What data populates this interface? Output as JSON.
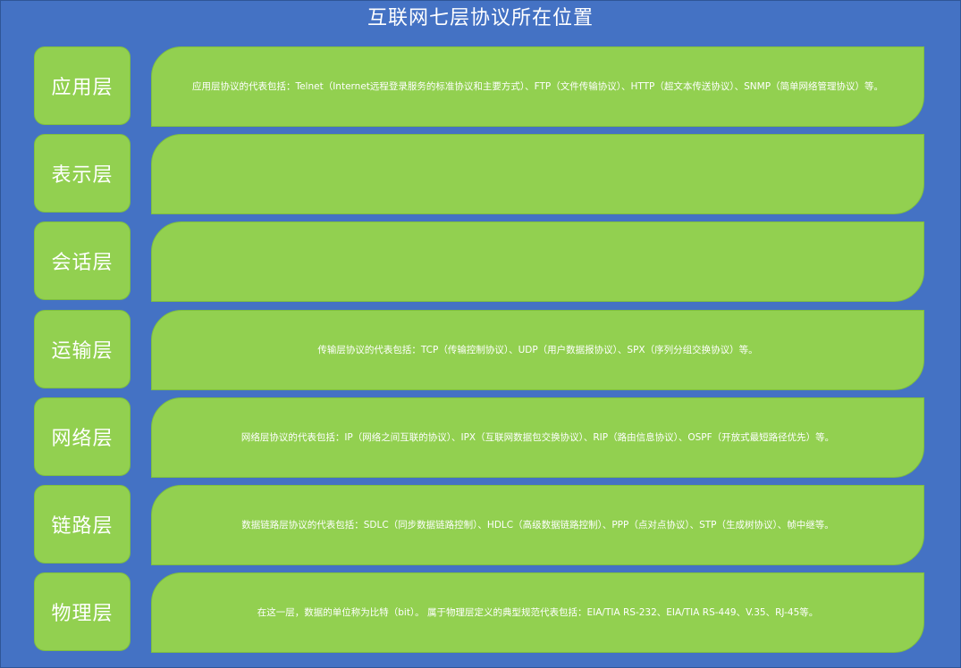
{
  "title": "互联网七层协议所在位置",
  "colors": {
    "background": "#4472C4",
    "box": "#92D050",
    "text": "#ffffff"
  },
  "layers": [
    {
      "name": "应用层",
      "description": "应用层协议的代表包括：Telnet（Internet远程登录服务的标准协议和主要方式）、FTP（文件传输协议）、HTTP（超文本传送协议）、SNMP（简单网络管理协议）等。"
    },
    {
      "name": "表示层",
      "description": ""
    },
    {
      "name": "会话层",
      "description": ""
    },
    {
      "name": "运输层",
      "description": "传输层协议的代表包括：TCP（传输控制协议）、UDP（用户数据报协议）、SPX（序列分组交换协议）等。"
    },
    {
      "name": "网络层",
      "description": "网络层协议的代表包括：IP（网络之间互联的协议）、IPX（互联网数据包交换协议）、RIP（路由信息协议）、OSPF（开放式最短路径优先）等。"
    },
    {
      "name": "链路层",
      "description": "数据链路层协议的代表包括：SDLC（同步数据链路控制）、HDLC（高级数据链路控制）、PPP（点对点协议）、STP（生成树协议）、帧中继等。"
    },
    {
      "name": "物理层",
      "description": "在这一层，数据的单位称为比特（bit）。 属于物理层定义的典型规范代表包括：EIA/TIA RS-232、EIA/TIA RS-449、V.35、RJ-45等。"
    }
  ]
}
